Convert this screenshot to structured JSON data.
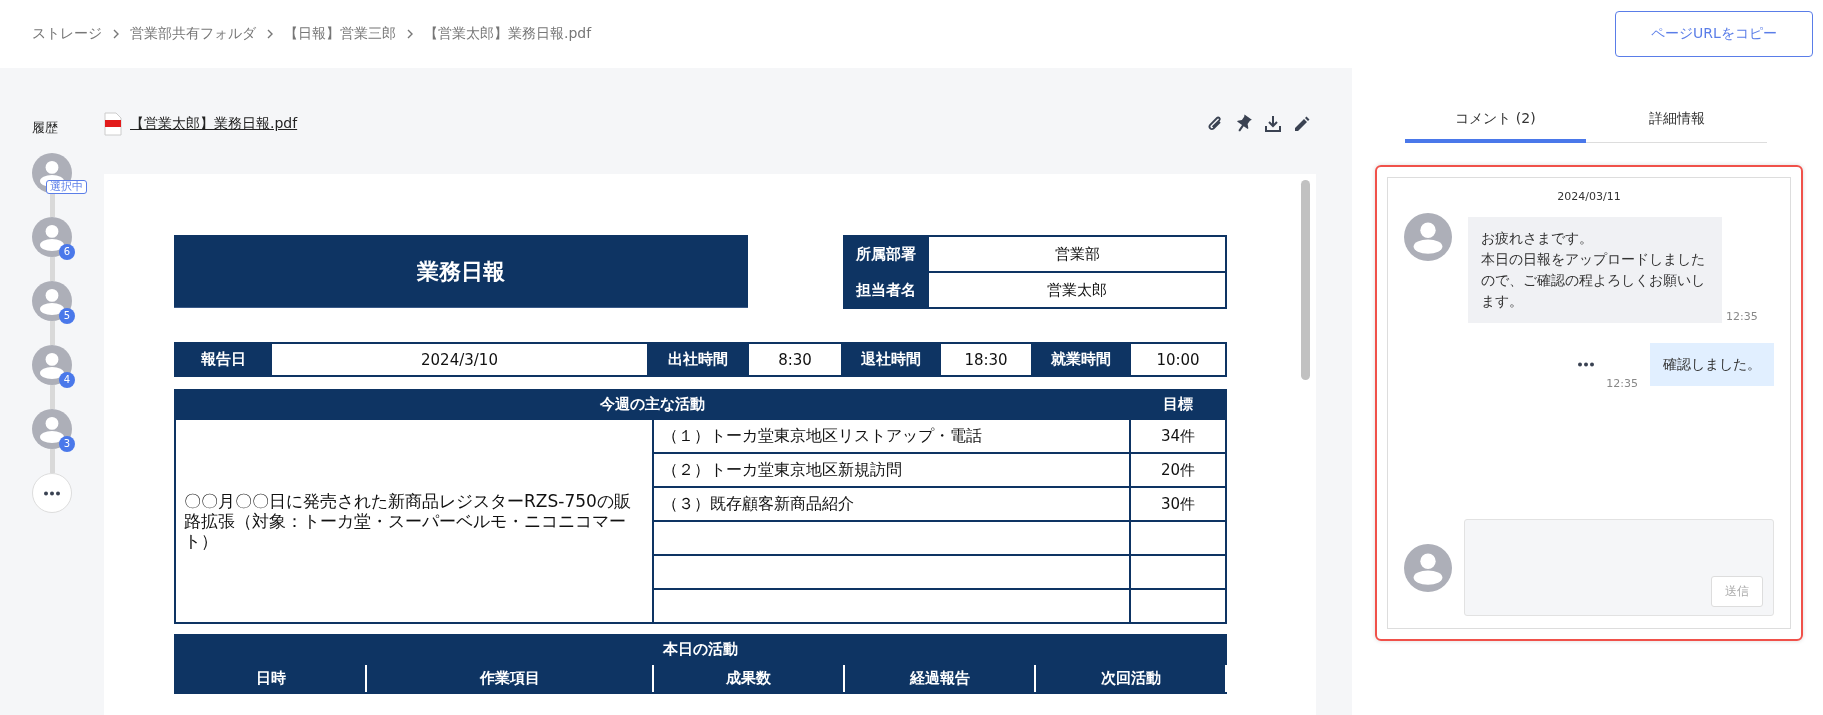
{
  "breadcrumb": [
    "ストレージ",
    "営業部共有フォルダ",
    "【日報】営業三郎",
    "【営業太郎】業務日報.pdf"
  ],
  "copy_button": "ページURLをコピー",
  "history": {
    "title": "履歴",
    "versions": [
      {
        "label": "選択中",
        "selected": true
      },
      {
        "label": "6",
        "selected": false
      },
      {
        "label": "5",
        "selected": false
      },
      {
        "label": "4",
        "selected": false
      },
      {
        "label": "3",
        "selected": false
      }
    ]
  },
  "file": {
    "name": "【営業太郎】業務日報.pdf"
  },
  "document": {
    "title": "業務日報",
    "info": [
      {
        "label": "所属部署",
        "value": "営業部"
      },
      {
        "label": "担当者名",
        "value": "営業太郎"
      }
    ],
    "times": [
      {
        "label": "報告日",
        "value": "2024/3/10"
      },
      {
        "label": "出社時間",
        "value": "8:30"
      },
      {
        "label": "退社時間",
        "value": "18:30"
      },
      {
        "label": "就業時間",
        "value": "10:00"
      }
    ],
    "weekly": {
      "heading": "今週の主な活動",
      "target_heading": "目標",
      "summary": "〇〇月〇〇日に発売された新商品レジスターRZS-750の販路拡張（対象：トーカ堂・スーパーベルモ・ニコニコマート）",
      "items": [
        {
          "text": "（１）トーカ堂東京地区リストアップ・電話",
          "target": "34件"
        },
        {
          "text": "（２）トーカ堂東京地区新規訪問",
          "target": "20件"
        },
        {
          "text": "（３）既存顧客新商品紹介",
          "target": "30件"
        }
      ]
    },
    "today": {
      "heading": "本日の活動",
      "columns": [
        "日時",
        "作業項目",
        "成果数",
        "経過報告",
        "次回活動"
      ]
    }
  },
  "tabs": [
    {
      "label": "コメント (2)",
      "selected": true
    },
    {
      "label": "詳細情報",
      "selected": false
    }
  ],
  "thread": {
    "date": "2024/03/11",
    "messages": [
      {
        "kind": "received",
        "lines": [
          "お疲れさまです。",
          "本日の日報をアップロードしましたので、ご確認の程よろしくお願いします。"
        ],
        "time": "12:35"
      },
      {
        "kind": "sent",
        "text": "確認しました。",
        "time": "12:35"
      }
    ],
    "composer": {
      "send": "送信",
      "disabled": true
    }
  }
}
